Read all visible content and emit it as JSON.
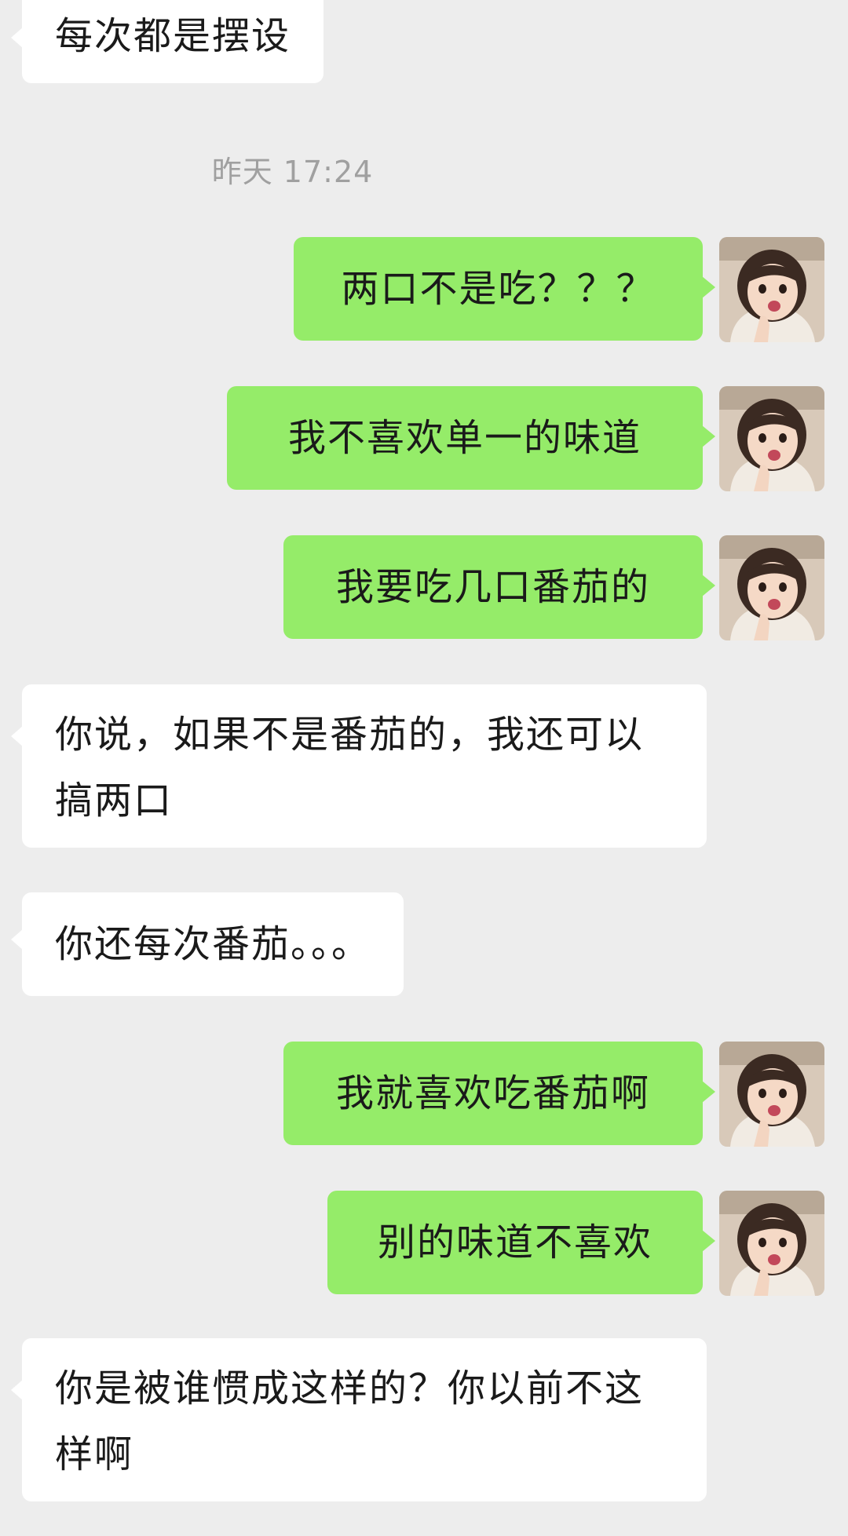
{
  "chat": {
    "timestamp": "昨天 17:24",
    "messages": [
      {
        "side": "in",
        "text": "每次都是摆设"
      },
      {
        "side": "out",
        "text": "两口不是吃？？？"
      },
      {
        "side": "out",
        "text": "我不喜欢单一的味道"
      },
      {
        "side": "out",
        "text": "我要吃几口番茄的"
      },
      {
        "side": "in",
        "text": "你说，如果不是番茄的，我还可以搞两口"
      },
      {
        "side": "in",
        "text": "你还每次番茄。。。"
      },
      {
        "side": "out",
        "text": "我就喜欢吃番茄啊"
      },
      {
        "side": "out",
        "text": "别的味道不喜欢"
      },
      {
        "side": "in",
        "text": "你是被谁惯成这样的？你以前不这样啊"
      }
    ],
    "avatar_icon": "girl-photo-avatar",
    "colors": {
      "background": "#ededed",
      "outgoing_bubble": "#95ec69",
      "incoming_bubble": "#ffffff",
      "timestamp_text": "#a0a0a0"
    }
  }
}
